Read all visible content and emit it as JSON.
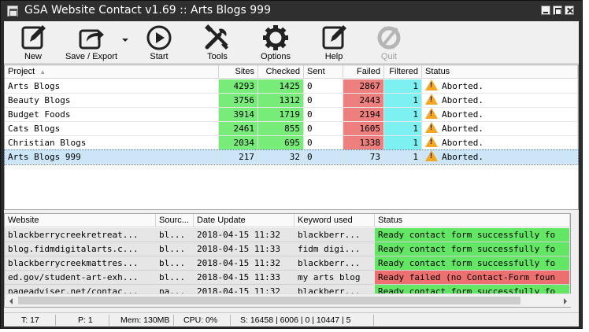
{
  "window": {
    "title": "GSA Website Contact v1.69 :: Arts Blogs 999"
  },
  "toolbar": {
    "buttons": [
      {
        "label": "New",
        "icon": "new-icon"
      },
      {
        "label": "Save / Export",
        "icon": "export-icon"
      },
      {
        "label": "Start",
        "icon": "play-icon"
      },
      {
        "label": "Tools",
        "icon": "tools-icon"
      },
      {
        "label": "Options",
        "icon": "gear-icon"
      },
      {
        "label": "Help",
        "icon": "help-icon"
      },
      {
        "label": "Quit",
        "icon": "quit-icon",
        "disabled": true
      }
    ]
  },
  "projects": {
    "columns": [
      "Project",
      "Sites",
      "Checked",
      "Sent",
      "Failed",
      "Filtered",
      "Status"
    ],
    "rows": [
      {
        "project": "Arts Blogs",
        "sites": "4293",
        "checked": "1425",
        "sent": "0",
        "failed": "2867",
        "filtered": "1",
        "status": "Aborted."
      },
      {
        "project": "Beauty Blogs",
        "sites": "3756",
        "checked": "1312",
        "sent": "0",
        "failed": "2443",
        "filtered": "1",
        "status": "Aborted."
      },
      {
        "project": "Budget Foods",
        "sites": "3914",
        "checked": "1719",
        "sent": "0",
        "failed": "2194",
        "filtered": "1",
        "status": "Aborted."
      },
      {
        "project": "Cats Blogs",
        "sites": "2461",
        "checked": "855",
        "sent": "0",
        "failed": "1605",
        "filtered": "1",
        "status": "Aborted."
      },
      {
        "project": "Christian Blogs",
        "sites": "2034",
        "checked": "695",
        "sent": "0",
        "failed": "1338",
        "filtered": "1",
        "status": "Aborted."
      },
      {
        "project": "Arts Blogs 999",
        "sites": "217",
        "checked": "32",
        "sent": "0",
        "failed": "73",
        "filtered": "1",
        "status": "Aborted."
      }
    ]
  },
  "log": {
    "columns": [
      "Website",
      "Sourc...",
      "Date Update",
      "Keyword used",
      "Status"
    ],
    "rows": [
      {
        "website": "blackberrycreekretreat...",
        "source": "bl...",
        "date": "2018-04-15 11:32",
        "keyword": "blackberr...",
        "status": "Ready contact form successfully fo",
        "kind": "ready"
      },
      {
        "website": "blog.fidmdigitalarts.c...",
        "source": "bl...",
        "date": "2018-04-15 11:33",
        "keyword": "fidm digi...",
        "status": "Ready contact form successfully fo",
        "kind": "ready"
      },
      {
        "website": "blackberrycreekmattres...",
        "source": "bl...",
        "date": "2018-04-15 11:32",
        "keyword": "blackberr...",
        "status": "Ready contact form successfully fo",
        "kind": "ready"
      },
      {
        "website": "ed.gov/student-art-exh...",
        "source": "bl...",
        "date": "2018-04-15 11:33",
        "keyword": "my arts blog",
        "status": "Ready failed (no Contact-Form foun",
        "kind": "fail"
      },
      {
        "website": "pageadviser.net/contac...",
        "source": "pa...",
        "date": "2018-04-15 11:32",
        "keyword": "blackberr...",
        "status": "Ready contact form successfully fo",
        "kind": "ready"
      }
    ]
  },
  "statusbar": {
    "threads": "T: 17",
    "projects": "P: 1",
    "memory": "Mem: 130MB",
    "cpu": "CPU: 0%",
    "stats": "S: 16458 | 6006 | 0 | 10447 | 5"
  },
  "colors": {
    "sites": "#78ec78",
    "failed": "#ee7f7f",
    "filtered": "#7df1f1",
    "ready": "#63e663",
    "fail": "#ee6f6f",
    "warning": "#f5a623"
  }
}
